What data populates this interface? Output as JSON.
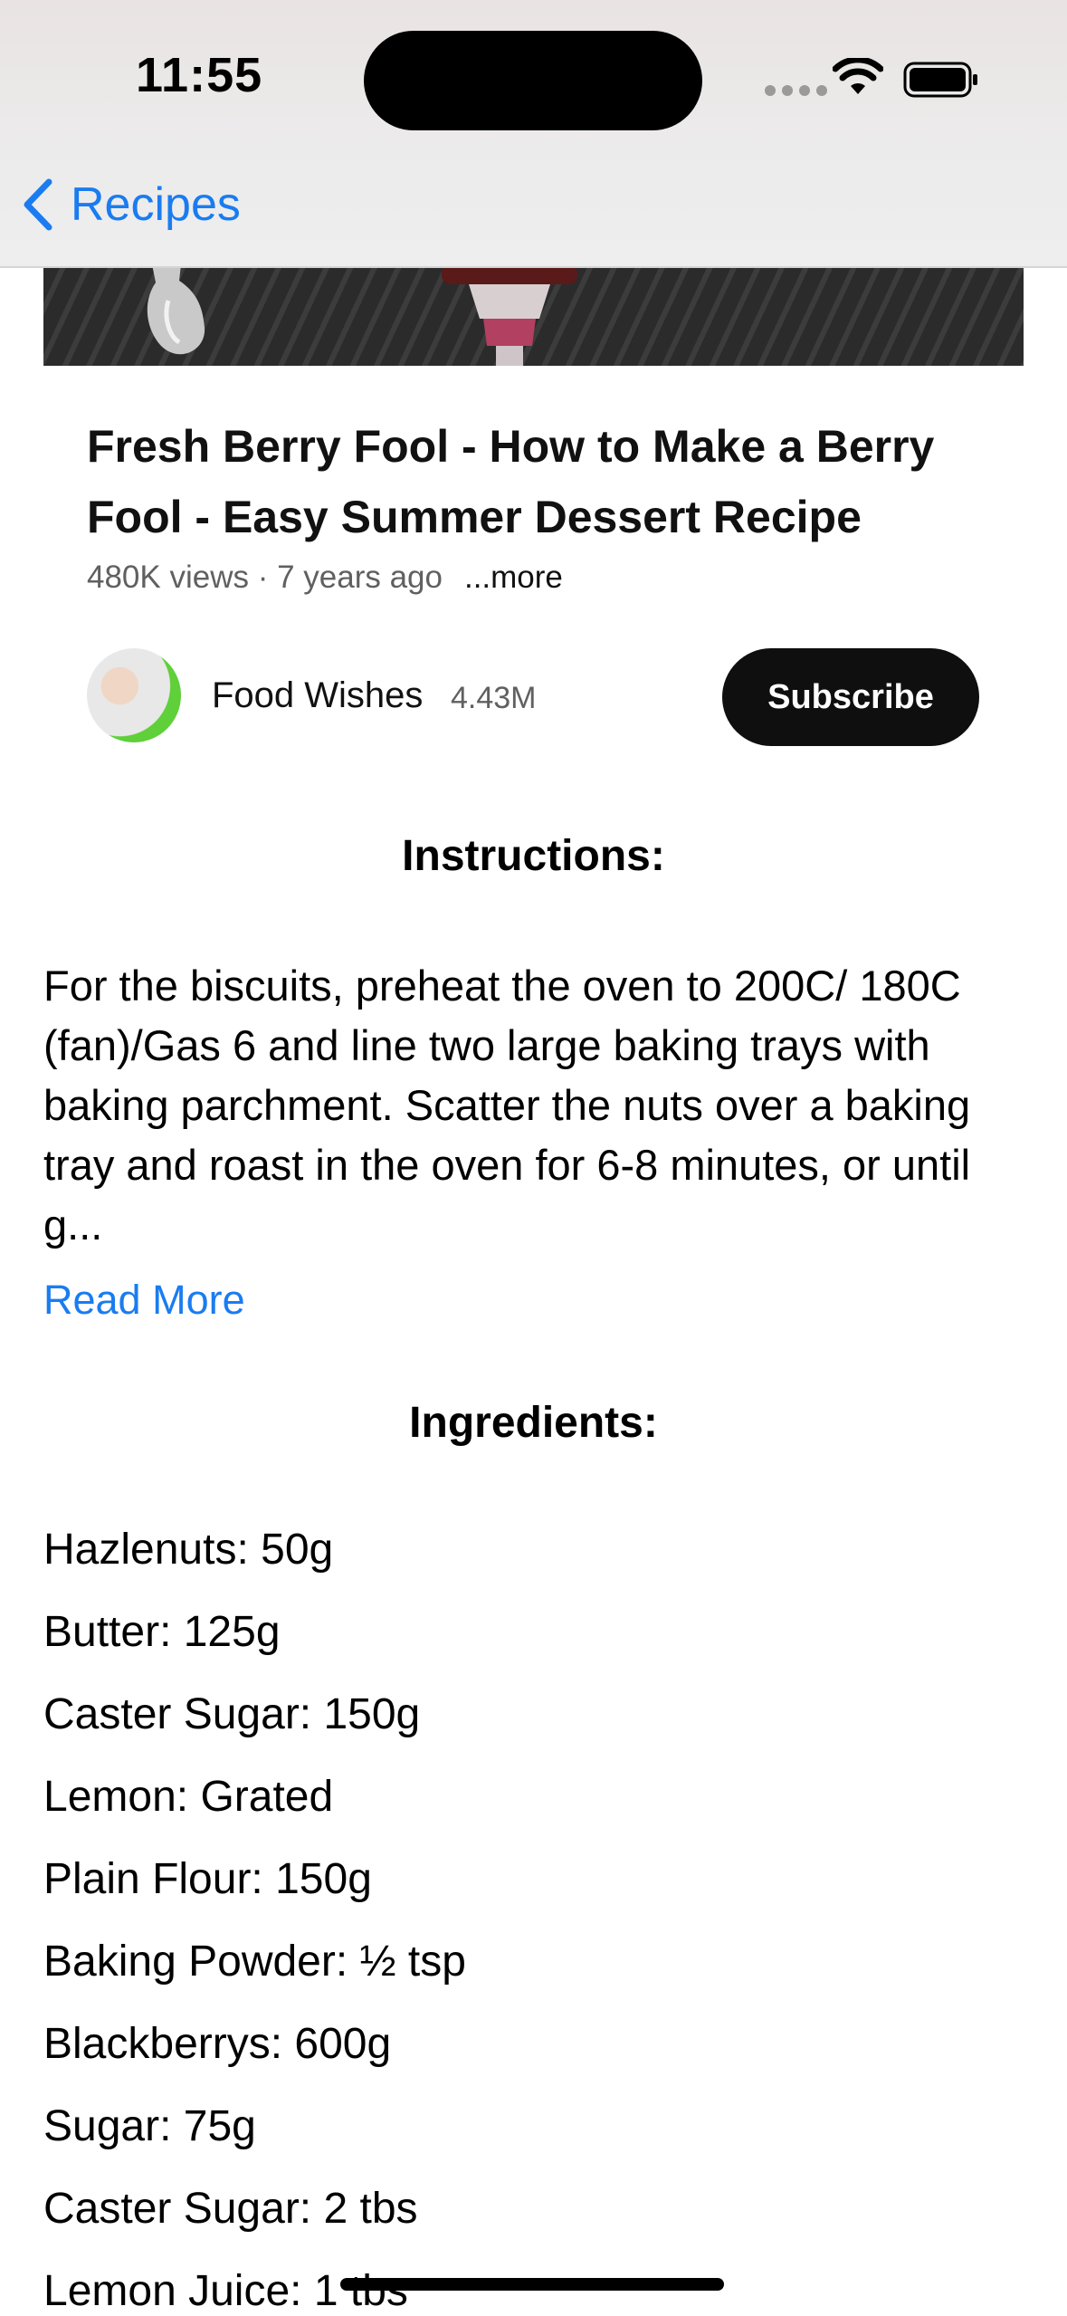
{
  "status_bar": {
    "time": "11:55"
  },
  "nav": {
    "back_label": "Recipes"
  },
  "video": {
    "title": "Fresh Berry Fool - How to Make a Berry Fool - Easy Summer Dessert Recipe",
    "meta": "480K views · 7 years ago",
    "more_label": "...more"
  },
  "channel": {
    "name": "Food Wishes",
    "subscribers": "4.43M",
    "subscribe_label": "Subscribe"
  },
  "instructions": {
    "heading": "Instructions:",
    "text": "For the biscuits, preheat the oven to 200C/ 180C (fan)/Gas 6 and line two large baking trays with baking parchment. Scatter the nuts over a baking tray and roast in the oven for 6-8 minutes, or until g...",
    "read_more_label": "Read More"
  },
  "ingredients": {
    "heading": "Ingredients:",
    "items": [
      "Hazlenuts: 50g",
      "Butter: 125g",
      "Caster Sugar: 150g",
      "Lemon: Grated",
      "Plain Flour: 150g",
      "Baking Powder: ½ tsp",
      "Blackberrys: 600g",
      "Sugar: 75g",
      "Caster Sugar: 2 tbs",
      "Lemon Juice: 1 tbs"
    ]
  },
  "colors": {
    "accent": "#1a7cf0",
    "subscribe_bg": "#0f0f0f"
  }
}
